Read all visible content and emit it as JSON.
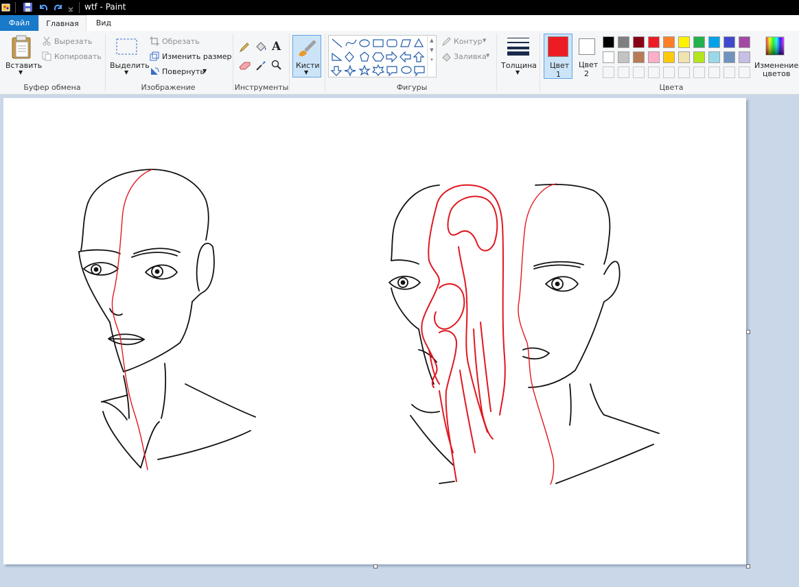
{
  "window": {
    "title": "wtf - Paint"
  },
  "tabs": {
    "file": "Файл",
    "home": "Главная",
    "view": "Вид"
  },
  "clipboard": {
    "paste": "Вставить",
    "cut": "Вырезать",
    "copy": "Копировать",
    "label": "Буфер обмена"
  },
  "image": {
    "select": "Выделить",
    "crop": "Обрезать",
    "resize": "Изменить размер",
    "rotate": "Повернуть",
    "label": "Изображение"
  },
  "tools": {
    "label": "Инструменты",
    "text_glyph": "A"
  },
  "brushes": {
    "label": "Кисти"
  },
  "shapes": {
    "outline": "Контур",
    "fill": "Заливка",
    "label": "Фигуры"
  },
  "size": {
    "label": "Толщина"
  },
  "colors": {
    "color1_label": "Цвет",
    "color1_num": "1",
    "color2_label": "Цвет",
    "color2_num": "2",
    "edit_label1": "Изменение",
    "edit_label2": "цветов",
    "label": "Цвета",
    "color1": "#ed1c24",
    "color2": "#ffffff",
    "palette_row1": [
      "#000000",
      "#7f7f7f",
      "#880015",
      "#ed1c24",
      "#ff7f27",
      "#fff200",
      "#22b14c",
      "#00a2e8",
      "#3f48cc",
      "#a349a4"
    ],
    "palette_row2": [
      "#ffffff",
      "#c3c3c3",
      "#b97a57",
      "#ffaec9",
      "#ffc90e",
      "#efe4b0",
      "#b5e61d",
      "#99d9ea",
      "#7092be",
      "#c8bfe7"
    ]
  }
}
